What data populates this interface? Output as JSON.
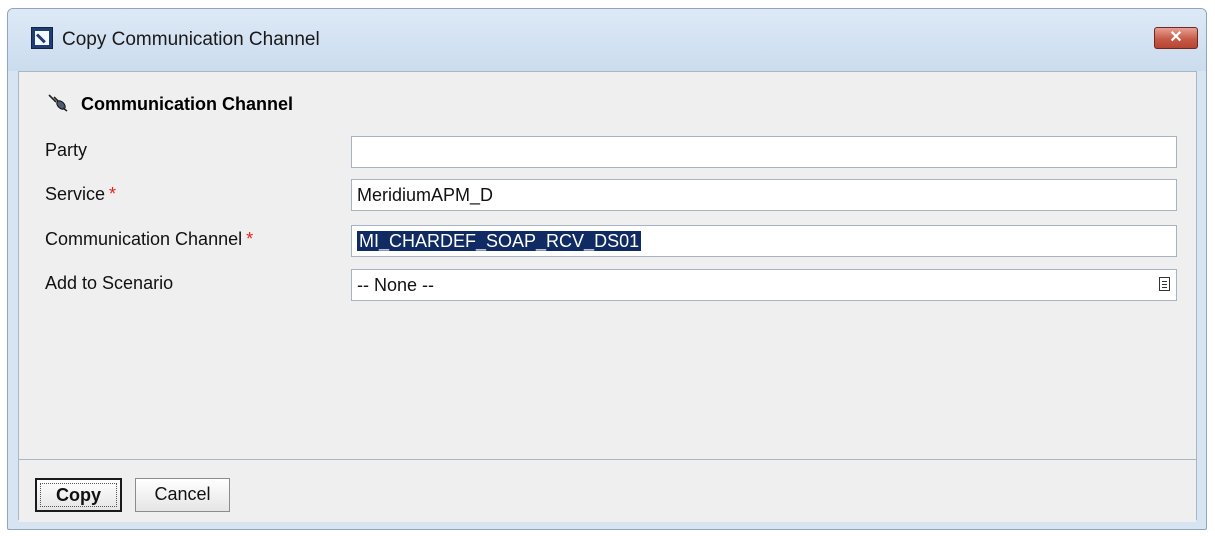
{
  "window": {
    "title": "Copy Communication Channel",
    "close_icon": "close-x-icon",
    "close_label": "✕"
  },
  "section": {
    "title": "Communication Channel",
    "icon": "channel-plug-icon"
  },
  "form": {
    "party": {
      "label": "Party",
      "value": ""
    },
    "service": {
      "label": "Service",
      "required_mark": "*",
      "value": "MeridiumAPM_D"
    },
    "channel": {
      "label": "Communication Channel",
      "required_mark": "*",
      "value": "MI_CHARDEF_SOAP_RCV_DS01"
    },
    "scenario": {
      "label": "Add to Scenario",
      "value": "-- None --"
    }
  },
  "buttons": {
    "copy": "Copy",
    "cancel": "Cancel"
  },
  "colors": {
    "selection": "#102b63",
    "required": "#e8221b",
    "close_button": "#c65a48"
  }
}
